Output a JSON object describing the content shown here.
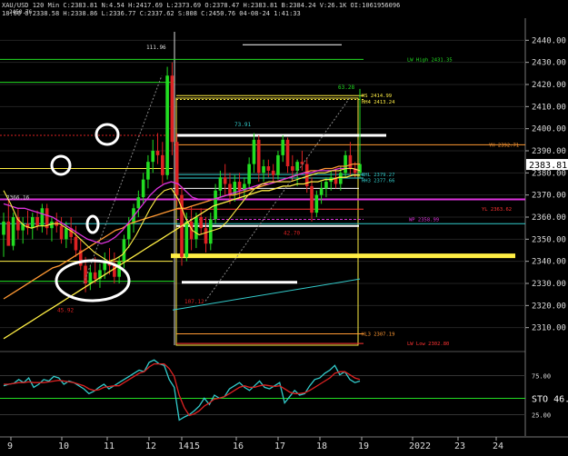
{
  "header": {
    "line1": "XAU/USD 120 Min C:2383.81 N:4.54 H:2417.69 L:2373.69 O:2378.47 H:2383.81 B:2384.24 V:26.1K OI:1061956096",
    "line2": "18:00 O:2338.58 H:2338.86 L:2336.77 C:2337.62 S:808 C:2450.76 04-08-24 1:41:33"
  },
  "chart_data": [
    {
      "type": "candlestick",
      "title": "XAU/USD 120 Min",
      "y_axis": {
        "ylim": [
          2300,
          2450
        ],
        "ticks": [
          2310,
          2320,
          2330,
          2340,
          2350,
          2360,
          2370,
          2380,
          2390,
          2400,
          2410,
          2420,
          2430,
          2440
        ],
        "tick_labels": [
          "2310.00",
          "2320.00",
          "2330.00",
          "2340.00",
          "2350.00",
          "2360.00",
          "2370.00",
          "2380.00",
          "2390.00",
          "2400.00",
          "2410.00",
          "2420.00",
          "2430.00",
          "2440.00"
        ]
      },
      "x_axis_labels": [
        "9",
        "10",
        "11",
        "12",
        "1415",
        "16",
        "17",
        "18",
        "19",
        "2022",
        "23",
        "24"
      ],
      "last_price": "2383.81",
      "price_lines": [
        {
          "label": "LW High 2431.35",
          "value": 2431.35,
          "color": "#22dd22"
        },
        {
          "label": "HS 2414.99",
          "value": 2414.99,
          "color": "#ffee44"
        },
        {
          "label": "HH4 2413.24",
          "value": 2413.24,
          "color": "#ffee44"
        },
        {
          "label": "YH 2392.71",
          "value": 2392.71,
          "color": "#ff9933"
        },
        {
          "label": "BHL 2379.27",
          "value": 2379.27,
          "color": "#33cccc"
        },
        {
          "label": "HH3 2377.66",
          "value": 2377.66,
          "color": "#33cccc"
        },
        {
          "label": "YL 2363.62",
          "value": 2363.62,
          "color": "#ff3333"
        },
        {
          "label": "WP 2358.99",
          "value": 2358.99,
          "color": "#dd33dd"
        },
        {
          "label": "HL3 2307.19",
          "value": 2307.19,
          "color": "#ff9933"
        },
        {
          "label": "LW Low 2302.80",
          "value": 2302.8,
          "color": "#ff3333"
        }
      ],
      "annotations": [
        "111.96",
        "73.91",
        "63.28",
        "45.92",
        "107.12",
        "42.70",
        "2450.76",
        "2366.16"
      ],
      "candles": [
        {
          "o": 2352,
          "h": 2362,
          "l": 2342,
          "c": 2358
        },
        {
          "o": 2358,
          "h": 2368,
          "l": 2348,
          "c": 2347
        },
        {
          "o": 2347,
          "h": 2362,
          "l": 2345,
          "c": 2360
        },
        {
          "o": 2360,
          "h": 2364,
          "l": 2350,
          "c": 2354
        },
        {
          "o": 2354,
          "h": 2360,
          "l": 2348,
          "c": 2357
        },
        {
          "o": 2357,
          "h": 2363,
          "l": 2352,
          "c": 2355
        },
        {
          "o": 2355,
          "h": 2362,
          "l": 2350,
          "c": 2360
        },
        {
          "o": 2360,
          "h": 2363,
          "l": 2354,
          "c": 2356
        },
        {
          "o": 2356,
          "h": 2366,
          "l": 2353,
          "c": 2364
        },
        {
          "o": 2364,
          "h": 2366,
          "l": 2352,
          "c": 2355
        },
        {
          "o": 2355,
          "h": 2360,
          "l": 2349,
          "c": 2358
        },
        {
          "o": 2358,
          "h": 2362,
          "l": 2353,
          "c": 2356
        },
        {
          "o": 2356,
          "h": 2360,
          "l": 2348,
          "c": 2350
        },
        {
          "o": 2350,
          "h": 2358,
          "l": 2346,
          "c": 2355
        },
        {
          "o": 2355,
          "h": 2360,
          "l": 2348,
          "c": 2351
        },
        {
          "o": 2351,
          "h": 2356,
          "l": 2342,
          "c": 2345
        },
        {
          "o": 2345,
          "h": 2350,
          "l": 2336,
          "c": 2338
        },
        {
          "o": 2338,
          "h": 2342,
          "l": 2326,
          "c": 2330
        },
        {
          "o": 2330,
          "h": 2338,
          "l": 2327,
          "c": 2335
        },
        {
          "o": 2335,
          "h": 2342,
          "l": 2330,
          "c": 2332
        },
        {
          "o": 2332,
          "h": 2339,
          "l": 2328,
          "c": 2336
        },
        {
          "o": 2336,
          "h": 2344,
          "l": 2332,
          "c": 2340
        },
        {
          "o": 2340,
          "h": 2346,
          "l": 2334,
          "c": 2338
        },
        {
          "o": 2338,
          "h": 2344,
          "l": 2330,
          "c": 2333
        },
        {
          "o": 2333,
          "h": 2342,
          "l": 2330,
          "c": 2340
        },
        {
          "o": 2340,
          "h": 2352,
          "l": 2337,
          "c": 2350
        },
        {
          "o": 2350,
          "h": 2360,
          "l": 2346,
          "c": 2357
        },
        {
          "o": 2357,
          "h": 2366,
          "l": 2353,
          "c": 2364
        },
        {
          "o": 2364,
          "h": 2372,
          "l": 2360,
          "c": 2369
        },
        {
          "o": 2369,
          "h": 2380,
          "l": 2366,
          "c": 2377
        },
        {
          "o": 2377,
          "h": 2388,
          "l": 2373,
          "c": 2385
        },
        {
          "o": 2385,
          "h": 2395,
          "l": 2380,
          "c": 2390
        },
        {
          "o": 2390,
          "h": 2398,
          "l": 2384,
          "c": 2388
        },
        {
          "o": 2388,
          "h": 2394,
          "l": 2375,
          "c": 2379
        },
        {
          "o": 2379,
          "h": 2428,
          "l": 2377,
          "c": 2424
        },
        {
          "o": 2424,
          "h": 2430,
          "l": 2388,
          "c": 2394
        },
        {
          "o": 2394,
          "h": 2398,
          "l": 2365,
          "c": 2370
        },
        {
          "o": 2370,
          "h": 2374,
          "l": 2338,
          "c": 2342
        },
        {
          "o": 2342,
          "h": 2362,
          "l": 2340,
          "c": 2358
        },
        {
          "o": 2358,
          "h": 2365,
          "l": 2345,
          "c": 2350
        },
        {
          "o": 2350,
          "h": 2362,
          "l": 2346,
          "c": 2360
        },
        {
          "o": 2360,
          "h": 2364,
          "l": 2352,
          "c": 2355
        },
        {
          "o": 2355,
          "h": 2360,
          "l": 2344,
          "c": 2348
        },
        {
          "o": 2348,
          "h": 2362,
          "l": 2345,
          "c": 2359
        },
        {
          "o": 2359,
          "h": 2375,
          "l": 2357,
          "c": 2372
        },
        {
          "o": 2372,
          "h": 2381,
          "l": 2369,
          "c": 2378
        },
        {
          "o": 2378,
          "h": 2384,
          "l": 2370,
          "c": 2375
        },
        {
          "o": 2375,
          "h": 2380,
          "l": 2366,
          "c": 2370
        },
        {
          "o": 2370,
          "h": 2379,
          "l": 2367,
          "c": 2376
        },
        {
          "o": 2376,
          "h": 2380,
          "l": 2368,
          "c": 2372
        },
        {
          "o": 2372,
          "h": 2378,
          "l": 2368,
          "c": 2375
        },
        {
          "o": 2375,
          "h": 2387,
          "l": 2373,
          "c": 2384
        },
        {
          "o": 2384,
          "h": 2398,
          "l": 2380,
          "c": 2395
        },
        {
          "o": 2395,
          "h": 2397,
          "l": 2376,
          "c": 2380
        },
        {
          "o": 2380,
          "h": 2386,
          "l": 2376,
          "c": 2383
        },
        {
          "o": 2383,
          "h": 2386,
          "l": 2378,
          "c": 2381
        },
        {
          "o": 2381,
          "h": 2384,
          "l": 2376,
          "c": 2379
        },
        {
          "o": 2379,
          "h": 2390,
          "l": 2377,
          "c": 2388
        },
        {
          "o": 2388,
          "h": 2397,
          "l": 2385,
          "c": 2395
        },
        {
          "o": 2395,
          "h": 2396,
          "l": 2380,
          "c": 2383
        },
        {
          "o": 2383,
          "h": 2388,
          "l": 2376,
          "c": 2381
        },
        {
          "o": 2381,
          "h": 2386,
          "l": 2374,
          "c": 2385
        },
        {
          "o": 2385,
          "h": 2390,
          "l": 2381,
          "c": 2384
        },
        {
          "o": 2384,
          "h": 2387,
          "l": 2371,
          "c": 2374
        },
        {
          "o": 2374,
          "h": 2378,
          "l": 2358,
          "c": 2362
        },
        {
          "o": 2362,
          "h": 2372,
          "l": 2360,
          "c": 2370
        },
        {
          "o": 2370,
          "h": 2376,
          "l": 2366,
          "c": 2373
        },
        {
          "o": 2373,
          "h": 2378,
          "l": 2369,
          "c": 2376
        },
        {
          "o": 2376,
          "h": 2381,
          "l": 2372,
          "c": 2378
        },
        {
          "o": 2378,
          "h": 2382,
          "l": 2373,
          "c": 2375
        },
        {
          "o": 2375,
          "h": 2383,
          "l": 2372,
          "c": 2380
        },
        {
          "o": 2380,
          "h": 2390,
          "l": 2378,
          "c": 2388
        },
        {
          "o": 2388,
          "h": 2394,
          "l": 2379,
          "c": 2382
        },
        {
          "o": 2382,
          "h": 2385,
          "l": 2378,
          "c": 2380
        },
        {
          "o": 2380,
          "h": 2418,
          "l": 2378,
          "c": 2384
        }
      ],
      "ma_yellow": [
        2372,
        2366,
        2359,
        2356,
        2355,
        2356,
        2356,
        2357,
        2357,
        2355,
        2353,
        2350,
        2347,
        2344,
        2342,
        2340,
        2341,
        2343,
        2347,
        2352,
        2358,
        2364,
        2369,
        2372,
        2373,
        2368,
        2360,
        2354,
        2352,
        2353,
        2354,
        2355,
        2358,
        2362,
        2366,
        2370,
        2373,
        2375,
        2376,
        2376,
        2376,
        2376,
        2377,
        2378,
        2379,
        2380,
        2380,
        2381,
        2381,
        2382,
        2382,
        2381
      ],
      "ma_magenta": [
        2366,
        2365,
        2364,
        2364,
        2363,
        2362,
        2361,
        2360,
        2358,
        2356,
        2354,
        2352,
        2350,
        2349,
        2348,
        2349,
        2351,
        2354,
        2358,
        2362,
        2366,
        2370,
        2373,
        2375,
        2376,
        2375,
        2372,
        2369,
        2368,
        2368,
        2368,
        2369,
        2370,
        2371,
        2372,
        2373,
        2374,
        2375,
        2375,
        2376,
        2377,
        2378,
        2379,
        2380,
        2380,
        2381,
        2381,
        2381,
        2382,
        2382,
        2382,
        2381
      ],
      "ma_orange": [
        2323,
        2325,
        2327,
        2329,
        2331,
        2333,
        2335,
        2337,
        2338,
        2340,
        2342,
        2344,
        2346,
        2348,
        2350,
        2352,
        2354,
        2355,
        2357,
        2358,
        2359,
        2360,
        2361,
        2362,
        2363,
        2364,
        2364,
        2365,
        2366,
        2367,
        2368,
        2369,
        2370,
        2370,
        2371,
        2372,
        2373,
        2374,
        2375,
        2376,
        2377,
        2378,
        2379,
        2380,
        2381,
        2381,
        2382,
        2382,
        2383,
        2383,
        2384,
        2384
      ],
      "ma_long": [
        2305,
        2307,
        2309,
        2311,
        2313,
        2315,
        2317,
        2319,
        2321,
        2323,
        2325,
        2327,
        2329,
        2331,
        2333,
        2335,
        2337,
        2339,
        2341,
        2343,
        2345,
        2347,
        2349,
        2351,
        2353,
        2355,
        2357,
        2359,
        2361,
        2363,
        2365,
        2366,
        2367,
        2368,
        2369,
        2370,
        2371,
        2372,
        2372,
        2373,
        2374,
        2374,
        2375,
        2375,
        2376,
        2376,
        2377,
        2377,
        2378,
        2378,
        2379,
        2379
      ]
    },
    {
      "type": "line",
      "title": "STO",
      "label": "STO 46.",
      "ylim": [
        0,
        100
      ],
      "ticks": [
        25,
        75
      ],
      "tick_labels": [
        "25.00",
        "75.00"
      ],
      "series": [
        {
          "name": "%K",
          "color": "#33cccc",
          "values": [
            62,
            64,
            65,
            70,
            66,
            72,
            60,
            64,
            70,
            68,
            74,
            72,
            64,
            68,
            66,
            62,
            58,
            52,
            55,
            60,
            64,
            58,
            62,
            66,
            70,
            74,
            78,
            82,
            80,
            92,
            95,
            90,
            88,
            70,
            60,
            18,
            22,
            25,
            30,
            36,
            46,
            38,
            50,
            46,
            48,
            58,
            62,
            66,
            60,
            56,
            62,
            68,
            60,
            58,
            62,
            66,
            40,
            48,
            56,
            50,
            52,
            62,
            70,
            72,
            78,
            82,
            88,
            76,
            80,
            70,
            66,
            68
          ]
        },
        {
          "name": "%D",
          "color": "#dd2222",
          "values": [
            64,
            64,
            65,
            66,
            66,
            67,
            66,
            66,
            66,
            67,
            68,
            69,
            68,
            67,
            66,
            64,
            62,
            58,
            56,
            57,
            60,
            61,
            62,
            62,
            66,
            70,
            74,
            78,
            80,
            86,
            90,
            90,
            90,
            84,
            74,
            50,
            34,
            24,
            26,
            30,
            36,
            40,
            45,
            46,
            48,
            52,
            56,
            60,
            62,
            60,
            60,
            62,
            63,
            62,
            61,
            62,
            58,
            54,
            52,
            52,
            53,
            56,
            60,
            64,
            68,
            72,
            78,
            80,
            80,
            76,
            72,
            70
          ]
        }
      ]
    }
  ]
}
